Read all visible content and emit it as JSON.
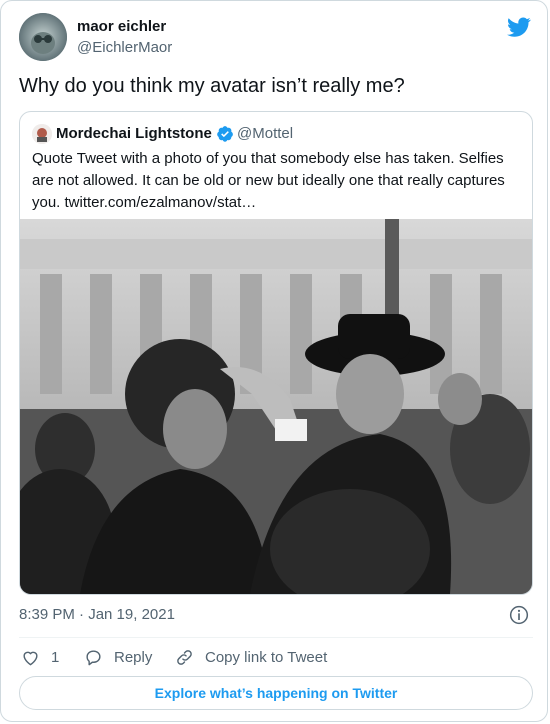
{
  "author": {
    "name": "maor eichler",
    "handle": "@EichlerMaor"
  },
  "tweet": {
    "text": "Why do you think my avatar isn’t really me?"
  },
  "quote": {
    "name": "Mordechai Lightstone",
    "handle": "@Mottel",
    "text": "Quote Tweet with a photo of you that somebody else has taken. Selfies are not allowed. It can be old or new but ideally one that really captures you. twitter.com/ezalmanov/stat…"
  },
  "meta": {
    "timestamp": "8:39 PM · Jan 19, 2021"
  },
  "actions": {
    "likes": "1",
    "reply_label": "Reply",
    "copy_label": "Copy link to Tweet"
  },
  "explore_label": "Explore what’s happening on Twitter",
  "colors": {
    "twitter_blue": "#1d9bf0",
    "muted": "#536471",
    "like_red": "#536471"
  },
  "icons": [
    "twitter-bird-icon",
    "verified-badge-icon",
    "info-icon",
    "heart-icon",
    "reply-icon",
    "link-icon"
  ]
}
